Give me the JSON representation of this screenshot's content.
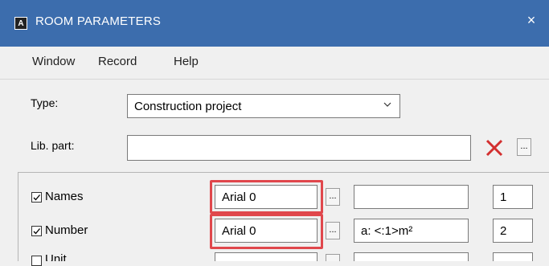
{
  "window": {
    "title": "ROOM PARAMETERS",
    "icon_letter": "A",
    "close_glyph": "×"
  },
  "menu": [
    "Window",
    "Record",
    "Help"
  ],
  "type_row": {
    "label": "Type:",
    "value": "Construction project"
  },
  "lib_row": {
    "label": "Lib. part:",
    "value": "",
    "clear_glyph": "✕",
    "browse_label": "..."
  },
  "rows": [
    {
      "label": "Names",
      "checked": true,
      "font": "Arial 0",
      "browse": "...",
      "format": "",
      "number": "1"
    },
    {
      "label": "Number",
      "checked": true,
      "font": "Arial 0",
      "browse": "...",
      "format": "a: <:1>m²",
      "number": "2"
    },
    {
      "label": "Unit",
      "checked": false,
      "font": "",
      "browse": "...",
      "format": "",
      "number": ""
    }
  ],
  "colors": {
    "titlebar": "#3c6dad",
    "highlight": "#e0474c",
    "clear_x": "#d32f2f"
  }
}
